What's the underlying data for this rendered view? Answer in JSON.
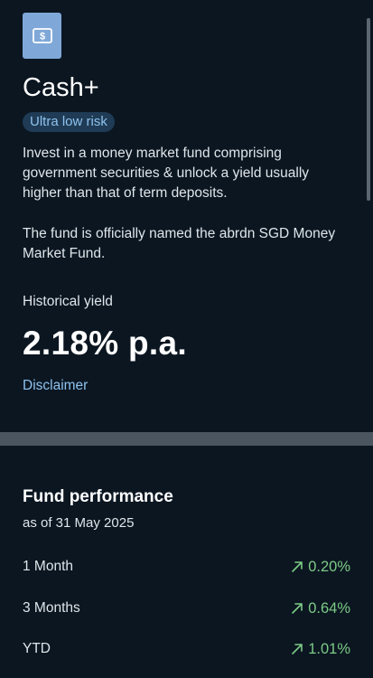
{
  "product": {
    "icon": "dollar-bill-icon",
    "title": "Cash+",
    "risk_badge": "Ultra low risk",
    "description": "Invest in a money market fund comprising government securities & unlock a yield usually higher than that of term deposits.",
    "official_name": "The fund is officially named the abrdn SGD Money Market Fund.",
    "yield_label": "Historical yield",
    "yield_value": "2.18% p.a.",
    "disclaimer_label": "Disclaimer"
  },
  "performance": {
    "title": "Fund performance",
    "as_of": "as of 31 May 2025",
    "rows": [
      {
        "label": "1 Month",
        "value": "0.20%",
        "icon": "trend-up-arrow-icon"
      },
      {
        "label": "3 Months",
        "value": "0.64%",
        "icon": "trend-up-arrow-icon"
      },
      {
        "label": "YTD",
        "value": "1.01%",
        "icon": "trend-up-arrow-icon"
      }
    ]
  },
  "colors": {
    "background": "#0b1621",
    "accent_blue": "#8ec2ee",
    "positive_green": "#7dcb86",
    "icon_tile": "#7fa8d8"
  }
}
